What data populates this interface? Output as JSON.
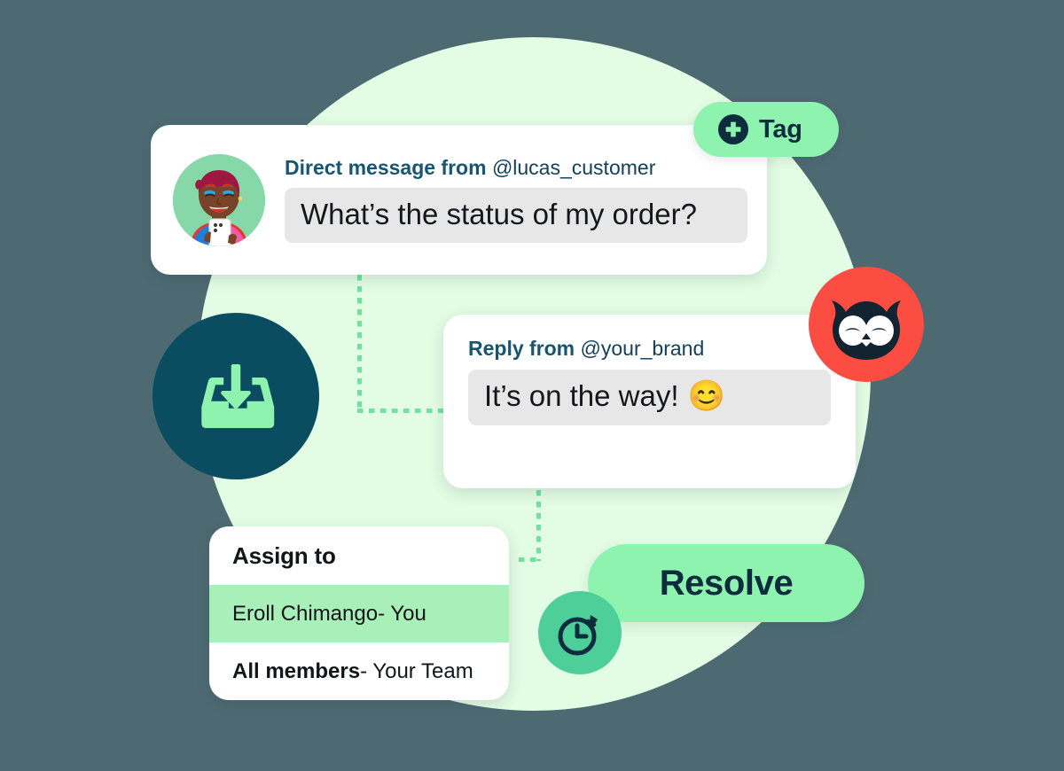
{
  "theme": {
    "page_background": "#4d6a72",
    "circle_background": "#e3fce4",
    "accent_mint": "#8df3ae",
    "accent_mint_light": "#a9efba",
    "brand_navy": "#0b4d60",
    "brand_red": "#fb4d42",
    "heading_blue": "#185571",
    "bubble_gray": "#e7e7e7",
    "dotted_line": "#6fe39a",
    "clock_green": "#4ecf9a"
  },
  "direct_message": {
    "icon": "avatar",
    "label_lead": "Direct message from",
    "handle": "@lucas_customer",
    "message": "What’s the status of my order?"
  },
  "reply": {
    "label_lead": "Reply from",
    "handle": "@your_brand",
    "message": "It’s on the way!",
    "emoji": "😊"
  },
  "tag_button": {
    "label": "Tag",
    "icon": "plus-circle-icon"
  },
  "resolve_button": {
    "label": "Resolve"
  },
  "assign_panel": {
    "title": "Assign to",
    "rows": [
      {
        "name": "Eroll Chimango",
        "suffix": " - You",
        "bold": false,
        "selected": true
      },
      {
        "name": "All members",
        "suffix": " - Your Team",
        "bold": true,
        "selected": false
      }
    ]
  },
  "icons": {
    "inbox": "inbox-download-icon",
    "clock": "stopwatch-icon",
    "owl": "hootsuite-owl-logo"
  }
}
